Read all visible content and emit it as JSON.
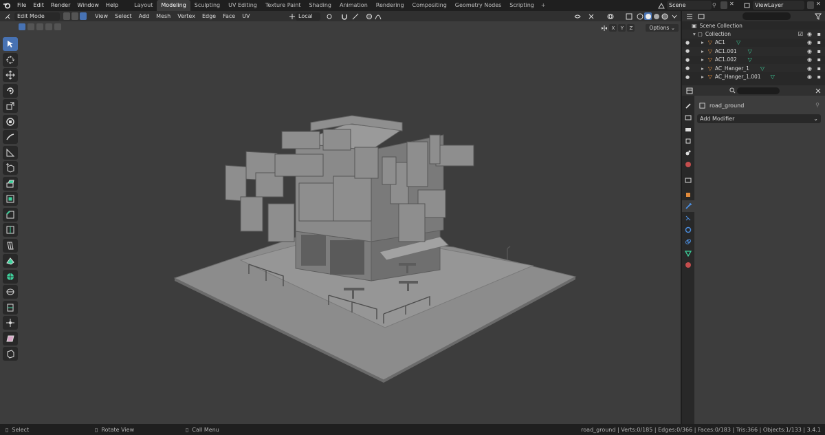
{
  "top_menu": [
    "File",
    "Edit",
    "Render",
    "Window",
    "Help"
  ],
  "workspace_tabs": [
    {
      "label": "Layout",
      "active": false
    },
    {
      "label": "Modeling",
      "active": true
    },
    {
      "label": "Sculpting",
      "active": false
    },
    {
      "label": "UV Editing",
      "active": false
    },
    {
      "label": "Texture Paint",
      "active": false
    },
    {
      "label": "Shading",
      "active": false
    },
    {
      "label": "Animation",
      "active": false
    },
    {
      "label": "Rendering",
      "active": false
    },
    {
      "label": "Compositing",
      "active": false
    },
    {
      "label": "Geometry Nodes",
      "active": false
    },
    {
      "label": "Scripting",
      "active": false
    }
  ],
  "add_workspace": "+",
  "scene_name": "Scene",
  "view_layer_name": "ViewLayer",
  "viewport": {
    "mode": "Edit Mode",
    "menus": [
      "View",
      "Select",
      "Add",
      "Mesh",
      "Vertex",
      "Edge",
      "Face",
      "UV"
    ],
    "transform_orientation": "Local",
    "options_label": "Options",
    "axes": [
      "X",
      "Y",
      "Z"
    ]
  },
  "toolbar_tools": [
    {
      "name": "select-box",
      "active": true
    },
    {
      "name": "cursor"
    },
    {
      "name": "move"
    },
    {
      "name": "rotate"
    },
    {
      "name": "scale"
    },
    {
      "name": "transform"
    },
    {
      "name": "annotate"
    },
    {
      "name": "measure"
    },
    {
      "name": "add-cube"
    },
    {
      "name": "extrude"
    },
    {
      "name": "inset"
    },
    {
      "name": "bevel"
    },
    {
      "name": "loop-cut"
    },
    {
      "name": "knife"
    },
    {
      "name": "poly-build"
    },
    {
      "name": "spin"
    },
    {
      "name": "smooth"
    },
    {
      "name": "edge-slide"
    },
    {
      "name": "shrink-fatten"
    },
    {
      "name": "shear"
    },
    {
      "name": "rip"
    }
  ],
  "outliner": {
    "scene_collection": "Scene Collection",
    "collection": "Collection",
    "items": [
      "AC1",
      "AC1.001",
      "AC1.002",
      "AC_Hanger_1",
      "AC_Hanger_1.001"
    ]
  },
  "properties": {
    "object_name": "road_ground",
    "add_modifier": "Add Modifier"
  },
  "status_bar": {
    "hints": [
      "Select",
      "Rotate View",
      "Call Menu"
    ],
    "stats": "road_ground | Verts:0/185 | Edges:0/366 | Faces:0/183 | Tris:366 | Objects:1/133 | 3.4.1"
  },
  "colors": {
    "accent": "#4772b3",
    "mesh_icon": "#e08a3a",
    "data_icon": "#3dd19c",
    "viewport_bg": "#3d3d3d",
    "mesh_gray": "#8c8c8c"
  }
}
